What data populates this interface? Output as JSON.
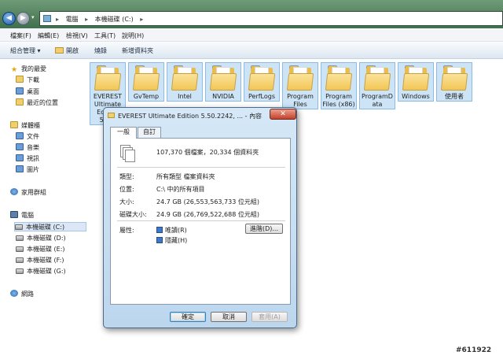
{
  "address_bar": {
    "back_glyph": "◀",
    "forward_glyph": "▶",
    "dropdown_glyph": "▾",
    "path": [
      "▸",
      "電腦",
      "▸",
      "本機磁碟 (C:)",
      "▸"
    ]
  },
  "menu": [
    "檔案(F)",
    "編輯(E)",
    "檢視(V)",
    "工具(T)",
    "說明(H)"
  ],
  "toolbar": {
    "organize": "組合管理 ▾",
    "open": "開啟",
    "burn": "燒錄",
    "new_folder": "新增資料夾"
  },
  "sidebar": {
    "favorites": "我的最愛",
    "downloads": "下載",
    "desktop": "桌面",
    "recent": "最近的位置",
    "libraries": "媒體櫃",
    "documents": "文件",
    "music": "音樂",
    "videos": "視訊",
    "pictures": "圖片",
    "homegroup": "家用群組",
    "computer": "電腦",
    "drives": [
      "本機磁碟 (C:)",
      "本機磁碟 (D:)",
      "本機磁碟 (E:)",
      "本機磁碟 (F:)",
      "本機磁碟 (G:)"
    ],
    "network": "網路",
    "star_glyph": "★"
  },
  "folders": [
    "EVEREST Ultimate Edition 5.5…",
    "GvTemp",
    "Intel",
    "NVIDIA",
    "PerfLogs",
    "Program Files",
    "Program Files (x86)",
    "ProgramData",
    "Windows",
    "使用者"
  ],
  "dialog": {
    "title": "EVEREST Ultimate Edition 5.50.2242, ... - 內容",
    "close_glyph": "✕",
    "tabs": [
      "一般",
      "自訂"
    ],
    "summary": "107,370 個檔案，20,334 個資料夾",
    "type_label": "類型:",
    "type_value": "所有類型 檔案資料夾",
    "location_label": "位置:",
    "location_value": "C:\\ 中的所有項目",
    "size_label": "大小:",
    "size_value": "24.7 GB (26,553,563,733 位元組)",
    "disk_size_label": "磁碟大小:",
    "disk_size_value": "24.9 GB (26,769,522,688 位元組)",
    "attributes_label": "屬性:",
    "readonly_label": "唯讀(R)",
    "hidden_label": "隱藏(H)",
    "advanced_button": "進階(D)...",
    "ok_button": "確定",
    "cancel_button": "取消",
    "apply_button": "套用(A)"
  },
  "watermark": "#611922"
}
